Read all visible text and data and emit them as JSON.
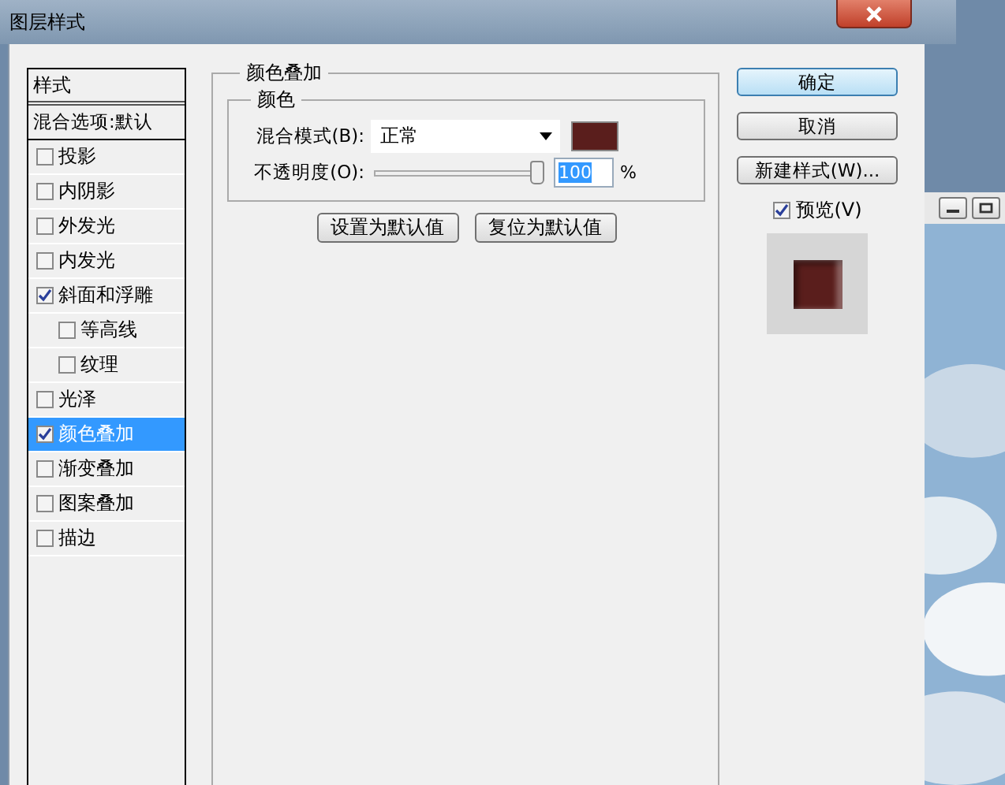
{
  "window": {
    "title": "图层样式"
  },
  "styles_list": {
    "header": "样式",
    "blend_options": "混合选项:默认",
    "items": [
      {
        "label": "投影",
        "checked": false,
        "selected": false
      },
      {
        "label": "内阴影",
        "checked": false,
        "selected": false
      },
      {
        "label": "外发光",
        "checked": false,
        "selected": false
      },
      {
        "label": "内发光",
        "checked": false,
        "selected": false
      },
      {
        "label": "斜面和浮雕",
        "checked": true,
        "selected": false,
        "children": [
          {
            "label": "等高线",
            "checked": false,
            "selected": false
          },
          {
            "label": "纹理",
            "checked": false,
            "selected": false
          }
        ]
      },
      {
        "label": "光泽",
        "checked": false,
        "selected": false
      },
      {
        "label": "颜色叠加",
        "checked": true,
        "selected": true
      },
      {
        "label": "渐变叠加",
        "checked": false,
        "selected": false
      },
      {
        "label": "图案叠加",
        "checked": false,
        "selected": false
      },
      {
        "label": "描边",
        "checked": false,
        "selected": false
      }
    ]
  },
  "panel": {
    "title": "颜色叠加",
    "group_title": "颜色",
    "blend_mode_label": "混合模式(B):",
    "blend_mode": "正常",
    "color": "#5a1e1c",
    "opacity_label": "不透明度(O):",
    "opacity": {
      "level": 1
    },
    "opacity_value": "100",
    "opacity_unit": "%",
    "buttons": [
      "设置为默认值",
      "复位为默认值"
    ]
  },
  "actions": {
    "buttons": [
      {
        "label": "确定",
        "focused": true
      },
      {
        "label": "取消",
        "focused": false
      },
      {
        "label": "新建样式(W)...",
        "focused": false
      }
    ],
    "preview_label": "预览(V)",
    "preview_checked": true
  }
}
